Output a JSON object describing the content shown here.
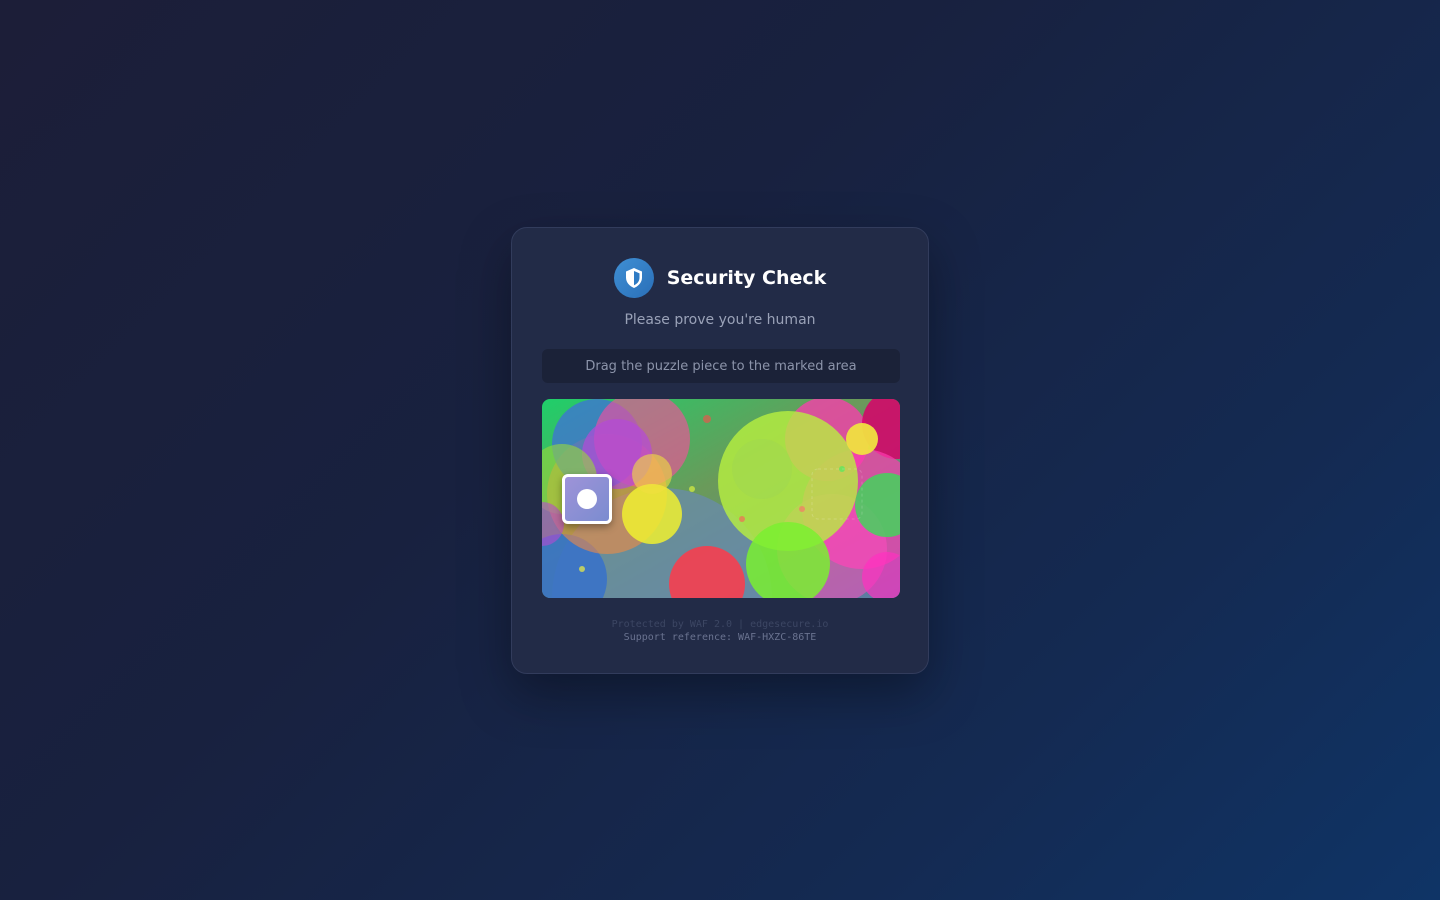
{
  "card": {
    "title": "Security Check",
    "subtitle": "Please prove you're human",
    "instruction": "Drag the puzzle piece to the marked area"
  },
  "icons": {
    "badge": "shield-check-icon",
    "piece": "puzzle-piece"
  },
  "footer": {
    "protected_by": "Protected by WAF 2.0 | edgesecure.io",
    "support_reference": "Support reference: WAF-HXZC-86TE"
  },
  "colors": {
    "accent": "#3f8fd4",
    "card_background": "#222b47",
    "piece": "#8f8fd4"
  }
}
